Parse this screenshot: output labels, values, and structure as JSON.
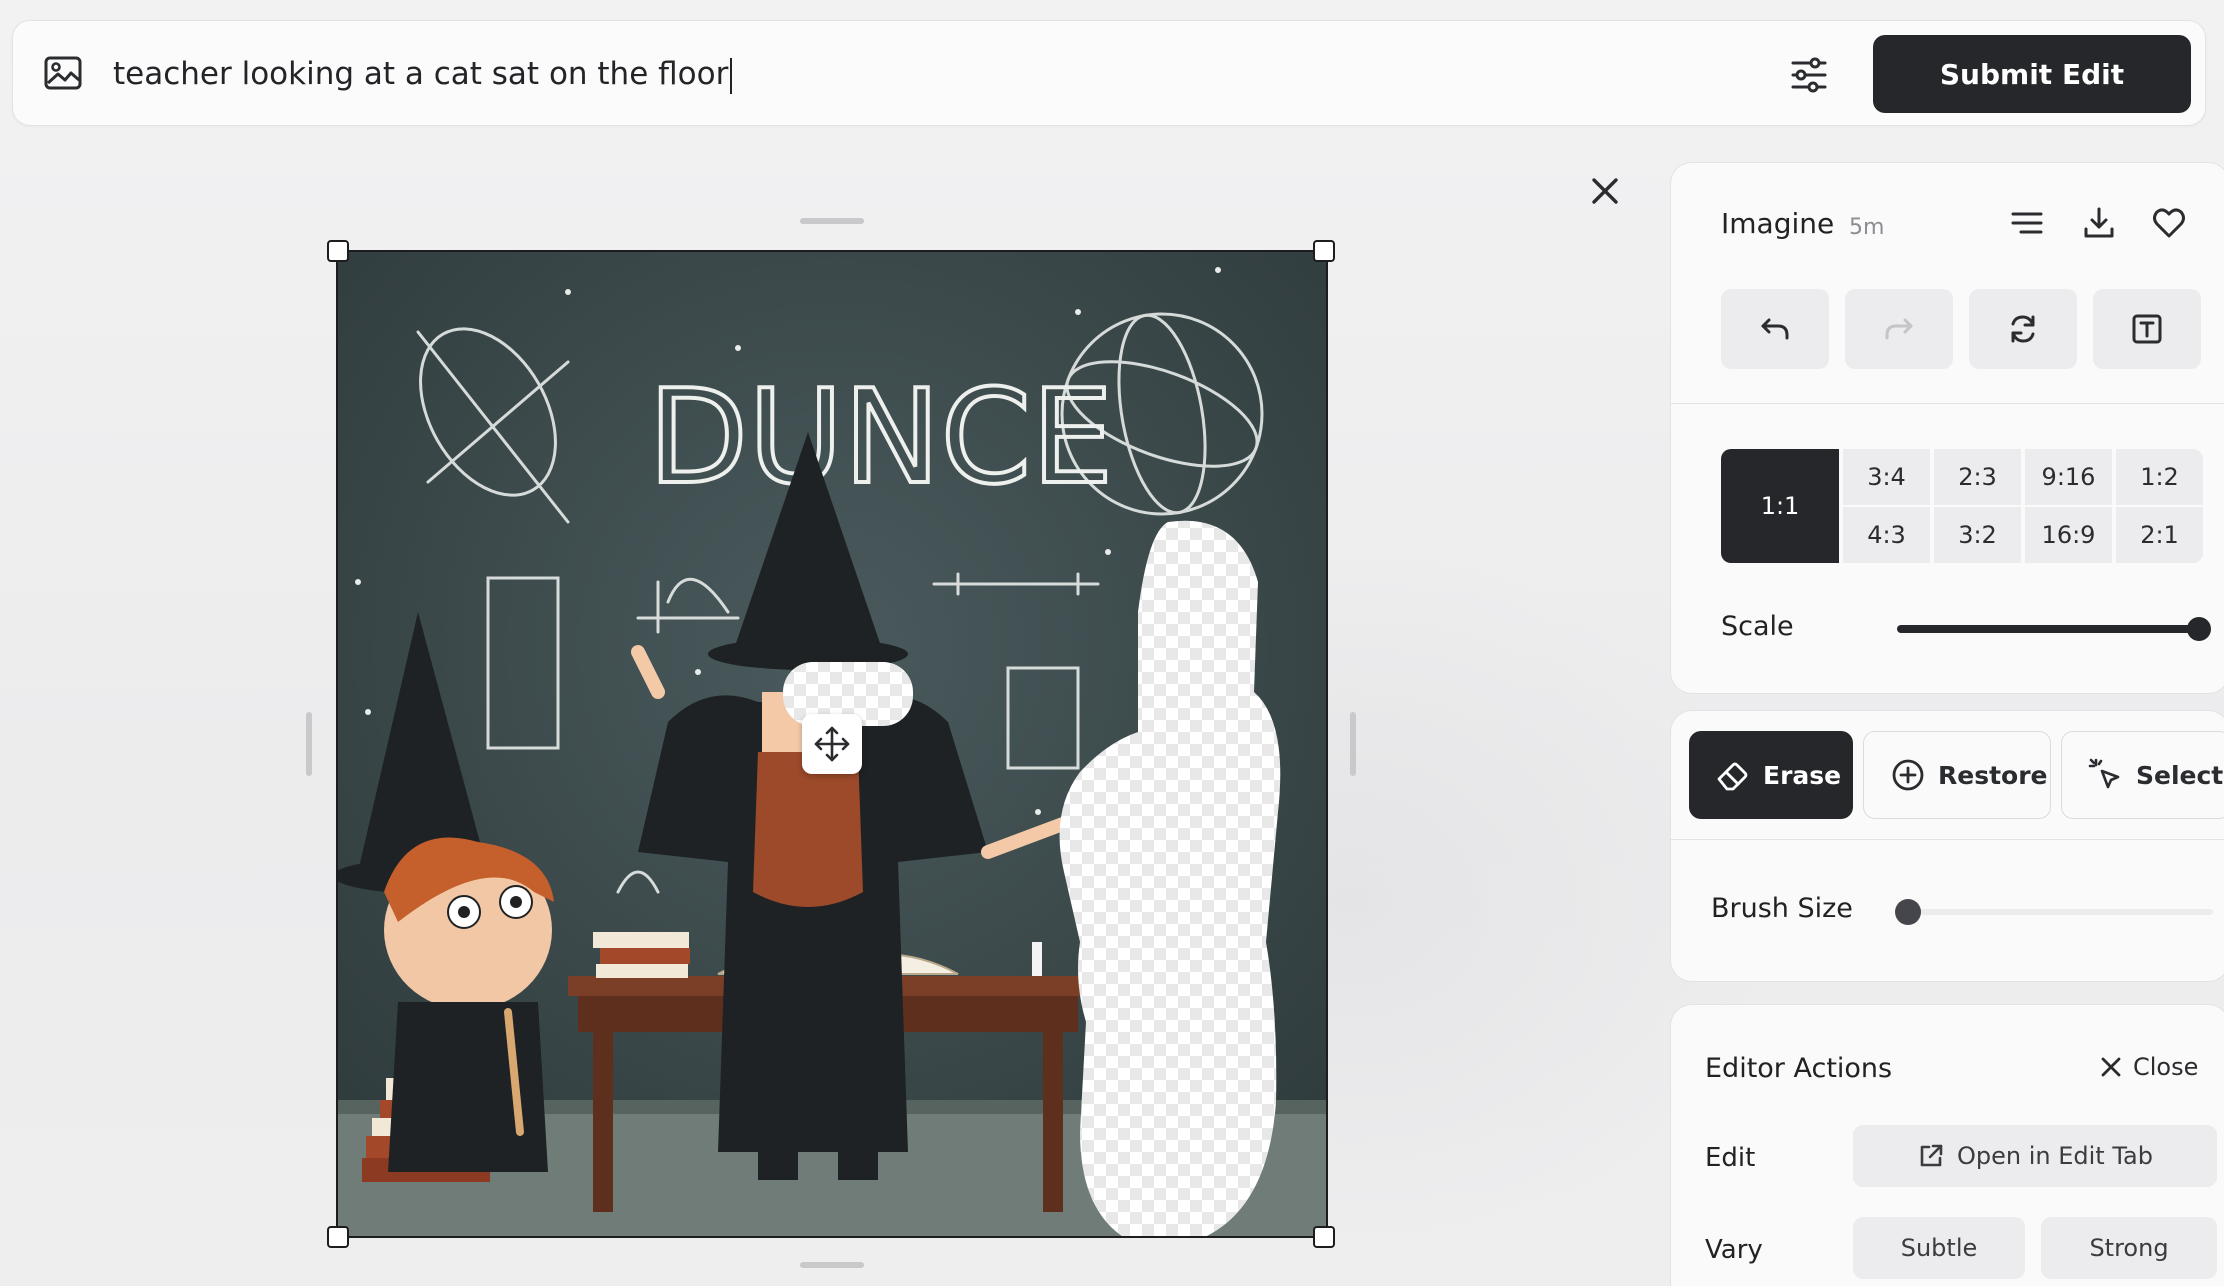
{
  "prompt": {
    "text": "teacher looking at a cat sat on the floor"
  },
  "submit": {
    "label": "Submit Edit"
  },
  "panel": {
    "title": "Imagine",
    "age": "5m",
    "aspect_ratios": {
      "selected": "1:1",
      "top_row": [
        "3:4",
        "2:3",
        "9:16",
        "1:2"
      ],
      "bottom_row": [
        "4:3",
        "3:2",
        "16:9",
        "2:1"
      ]
    },
    "scale_label": "Scale",
    "scale_value": 1.0
  },
  "tools": {
    "erase_label": "Erase",
    "restore_label": "Restore",
    "select_label": "Select",
    "brush_label": "Brush Size",
    "brush_value": 0.0
  },
  "actions": {
    "title": "Editor Actions",
    "close_label": "Close",
    "edit_label": "Edit",
    "open_edit_label": "Open in Edit Tab",
    "vary_label": "Vary",
    "subtle_label": "Subtle",
    "strong_label": "Strong"
  },
  "image": {
    "chalk_text": "DUNCE"
  },
  "colors": {
    "dark": "#25272b",
    "chalkboard": "#3d4c4e",
    "panel_bg": "#fafafa",
    "button_gray": "#ececee"
  },
  "icons": [
    "image-icon",
    "sliders-icon",
    "close-icon",
    "lines-icon",
    "download-icon",
    "heart-icon",
    "undo-icon",
    "redo-icon",
    "refresh-icon",
    "text-box-icon",
    "eraser-icon",
    "plus-circle-icon",
    "sparkle-cursor-icon",
    "external-link-icon",
    "move-icon"
  ]
}
